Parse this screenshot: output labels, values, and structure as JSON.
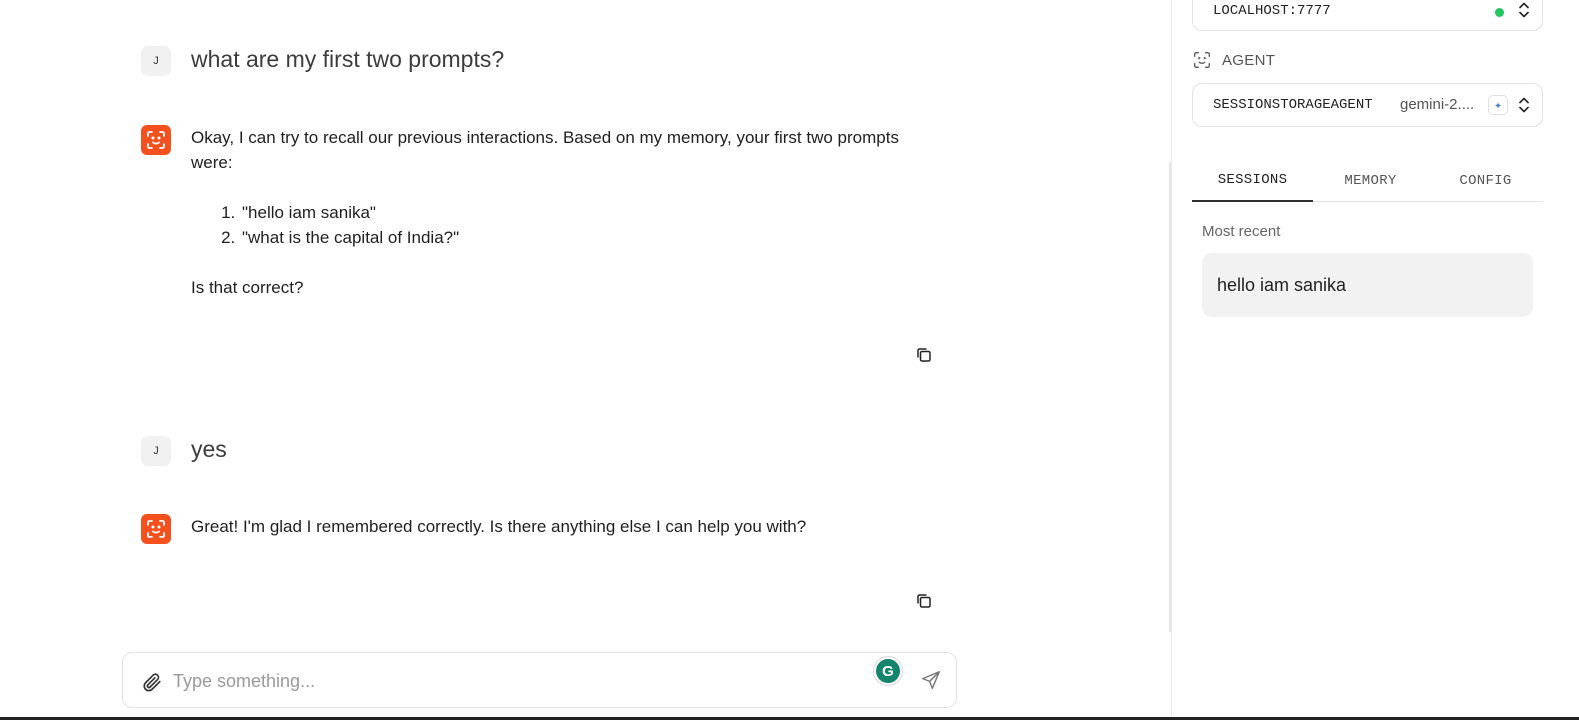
{
  "conversation": {
    "messages": [
      {
        "role": "user",
        "avatar": "J",
        "text": "what are my first two prompts?"
      },
      {
        "role": "agent",
        "intro": "Okay, I can try to recall our previous interactions. Based on my memory, your first two prompts were:",
        "list": [
          "\"hello iam sanika\"",
          "\"what is the capital of India?\""
        ],
        "outro": "Is that correct?"
      },
      {
        "role": "user",
        "avatar": "J",
        "text": "yes"
      },
      {
        "role": "agent",
        "intro": "Great! I'm glad I remembered correctly. Is there anything else I can help you with?"
      }
    ]
  },
  "input": {
    "placeholder": "Type something...",
    "value": ""
  },
  "panel": {
    "server": {
      "value": "LOCALHOST:7777",
      "status_color": "#22c55e"
    },
    "agent_label": "AGENT",
    "agent": {
      "name": "SESSIONSTORAGEAGENT",
      "model": "gemini-2...."
    },
    "tabs": [
      {
        "label": "SESSIONS",
        "active": true
      },
      {
        "label": "MEMORY",
        "active": false
      },
      {
        "label": "CONFIG",
        "active": false
      }
    ],
    "recent_label": "Most recent",
    "sessions": [
      {
        "title": "hello iam sanika"
      }
    ]
  },
  "colors": {
    "agent_avatar": "#f4511e",
    "grammarly": "#15846c",
    "accent": "#4a7be8"
  },
  "icons": {
    "agent_avatar": "agent-face-icon",
    "copy": "copy-icon",
    "attach": "paperclip-icon",
    "send": "send-icon",
    "grammarly": "grammarly-icon",
    "agent_label": "agent-frame-icon",
    "selector": "chevron-up-down-icon",
    "model": "sparkle-icon"
  }
}
